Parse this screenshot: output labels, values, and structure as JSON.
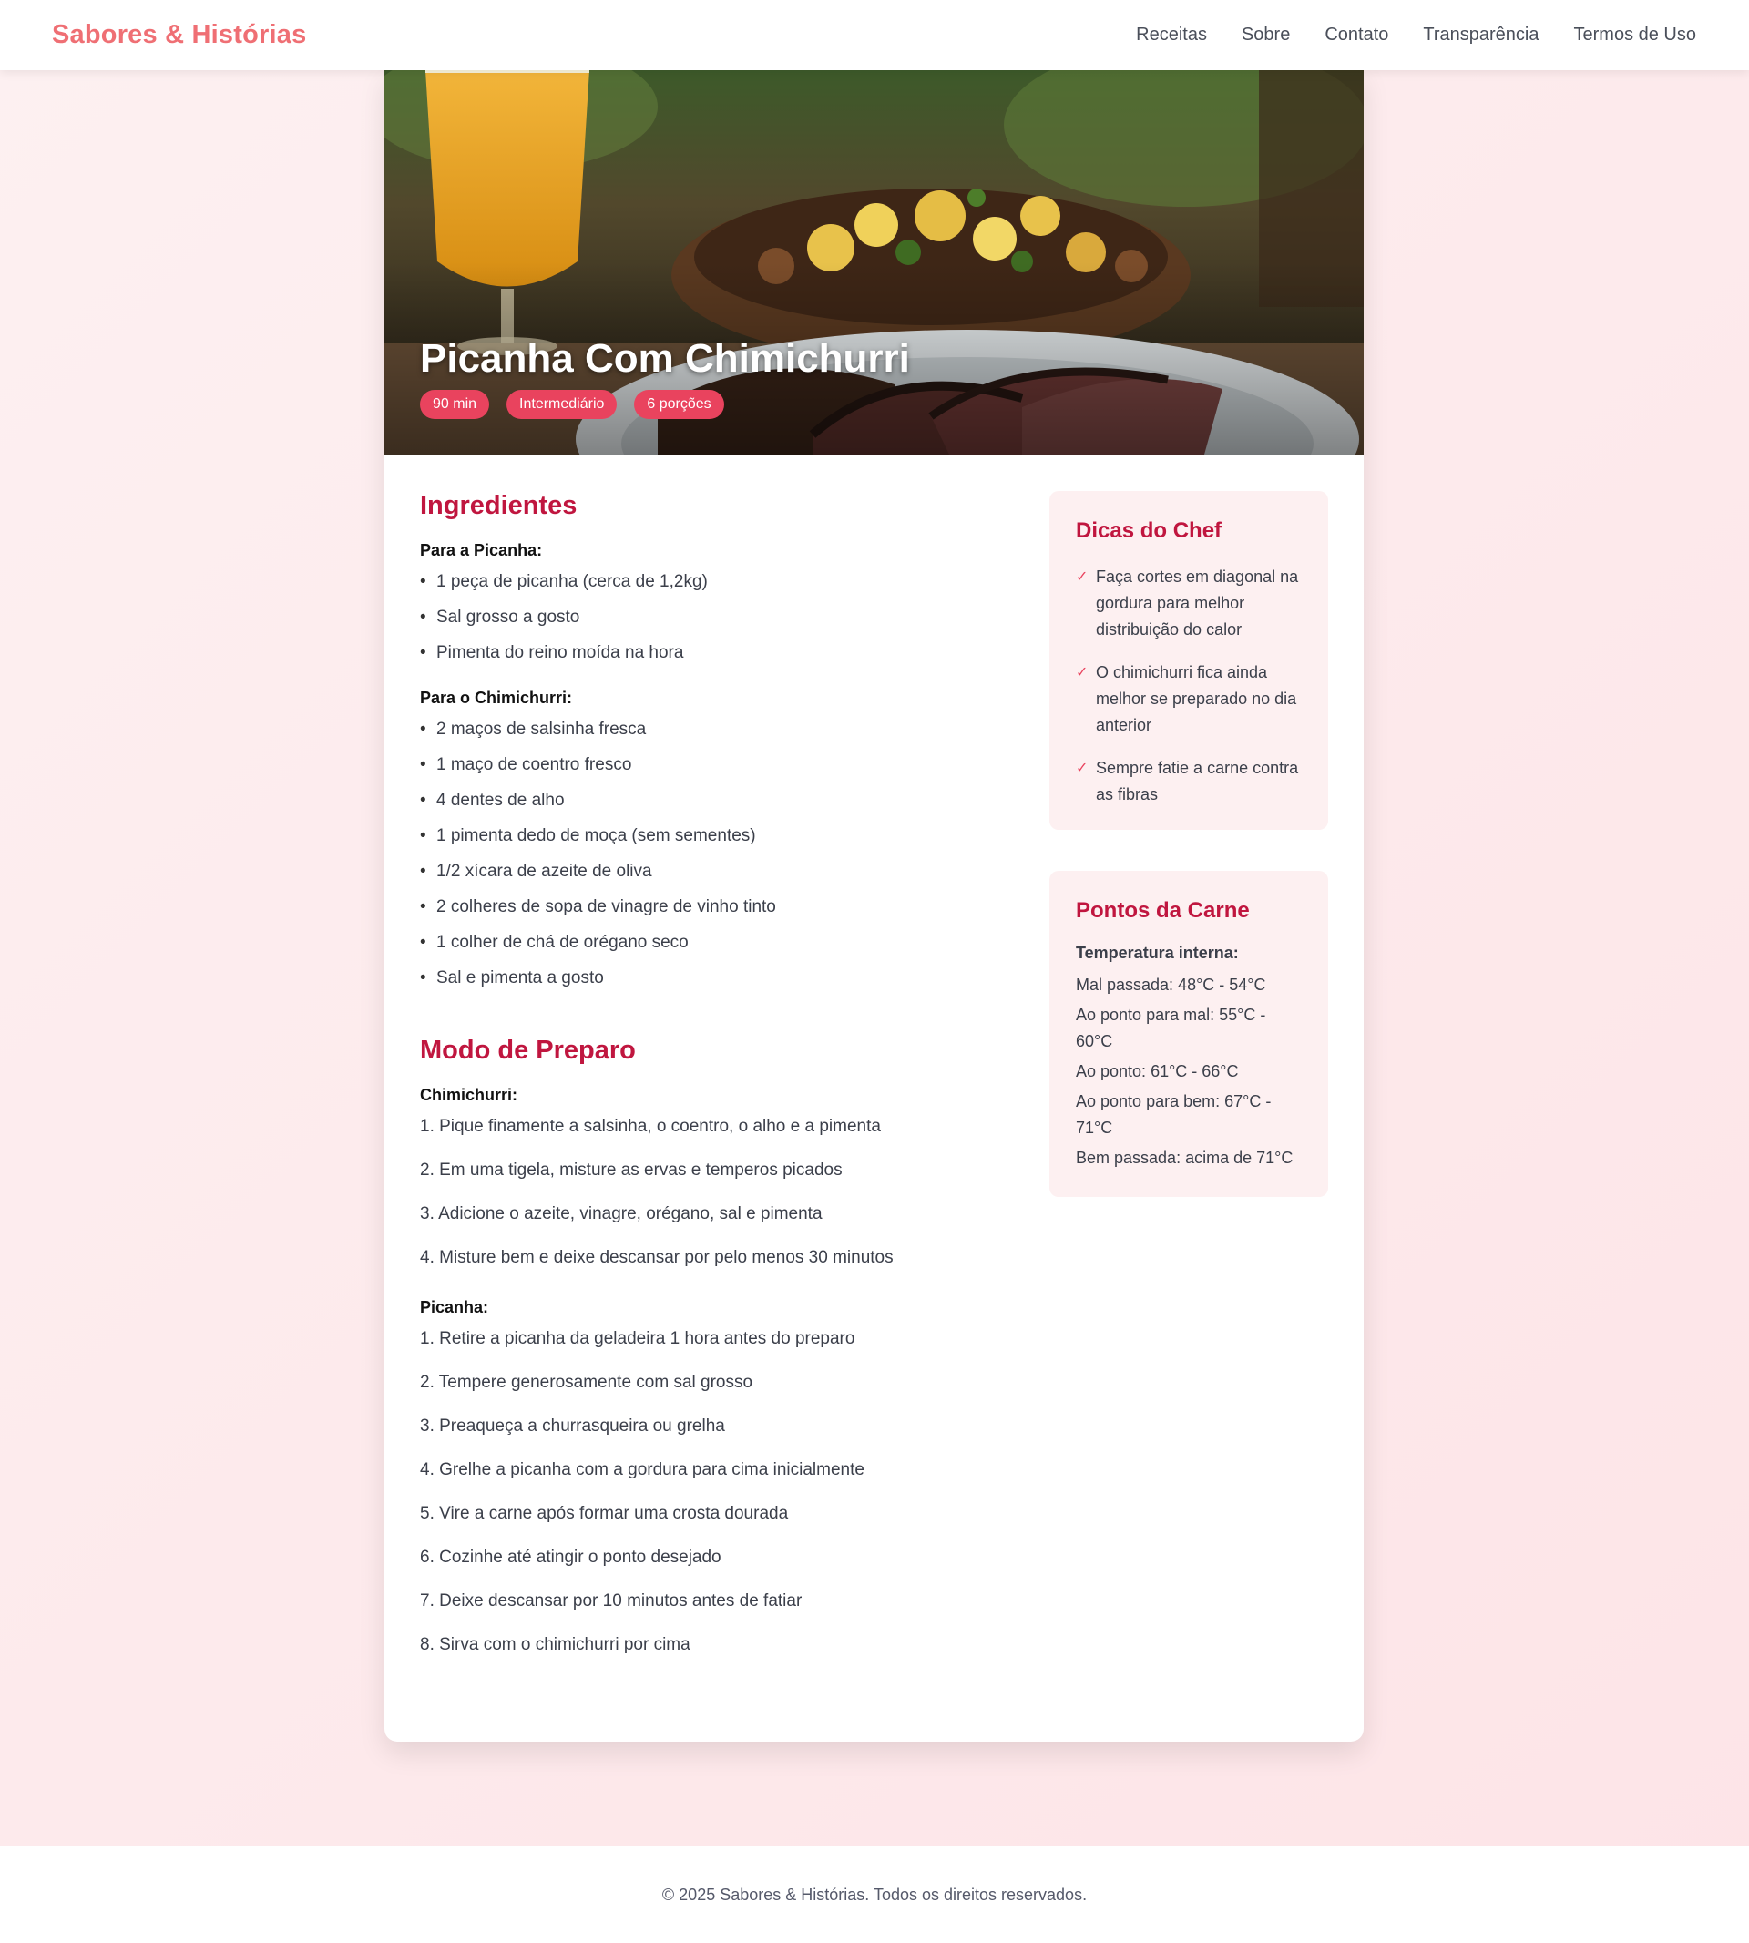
{
  "header": {
    "brand": "Sabores & Histórias",
    "nav": [
      "Receitas",
      "Sobre",
      "Contato",
      "Transparência",
      "Termos de Uso"
    ]
  },
  "hero": {
    "title": "Picanha Com Chimichurri",
    "badges": [
      "90 min",
      "Intermediário",
      "6 porções"
    ],
    "image_icon": "grilled-picanha-photo"
  },
  "ingredients": {
    "title": "Ingredientes",
    "groups": [
      {
        "title": "Para a Picanha:",
        "items": [
          "1 peça de picanha (cerca de 1,2kg)",
          "Sal grosso a gosto",
          "Pimenta do reino moída na hora"
        ]
      },
      {
        "title": "Para o Chimichurri:",
        "items": [
          "2 maços de salsinha fresca",
          "1 maço de coentro fresco",
          "4 dentes de alho",
          "1 pimenta dedo de moça (sem sementes)",
          "1/2 xícara de azeite de oliva",
          "2 colheres de sopa de vinagre de vinho tinto",
          "1 colher de chá de orégano seco",
          "Sal e pimenta a gosto"
        ]
      }
    ]
  },
  "preparation": {
    "title": "Modo de Preparo",
    "groups": [
      {
        "title": "Chimichurri:",
        "steps": [
          "1. Pique finamente a salsinha, o coentro, o alho e a pimenta",
          "2. Em uma tigela, misture as ervas e temperos picados",
          "3. Adicione o azeite, vinagre, orégano, sal e pimenta",
          "4. Misture bem e deixe descansar por pelo menos 30 minutos"
        ]
      },
      {
        "title": "Picanha:",
        "steps": [
          "1. Retire a picanha da geladeira 1 hora antes do preparo",
          "2. Tempere generosamente com sal grosso",
          "3. Preaqueça a churrasqueira ou grelha",
          "4. Grelhe a picanha com a gordura para cima inicialmente",
          "5. Vire a carne após formar uma crosta dourada",
          "6. Cozinhe até atingir o ponto desejado",
          "7. Deixe descansar por 10 minutos antes de fatiar",
          "8. Sirva com o chimichurri por cima"
        ]
      }
    ]
  },
  "tips": {
    "title": "Dicas do Chef",
    "check_icon": "checkmark-icon",
    "items": [
      "Faça cortes em diagonal na gordura para melhor distribuição do calor",
      "O chimichurri fica ainda melhor se preparado no dia anterior",
      "Sempre fatie a carne contra as fibras"
    ]
  },
  "doneness": {
    "title": "Pontos da Carne",
    "heading": "Temperatura interna:",
    "items": [
      "Mal passada: 48°C - 54°C",
      "Ao ponto para mal: 55°C - 60°C",
      "Ao ponto: 61°C - 66°C",
      "Ao ponto para bem: 67°C - 71°C",
      "Bem passada: acima de 71°C"
    ]
  },
  "footer": {
    "text": "© 2025 Sabores & Histórias. Todos os direitos reservados."
  },
  "colors": {
    "brand": "#ef6f74",
    "accent": "#c0163f",
    "badge": "#e9435e",
    "sidebar_bg": "#fdf0f1"
  }
}
